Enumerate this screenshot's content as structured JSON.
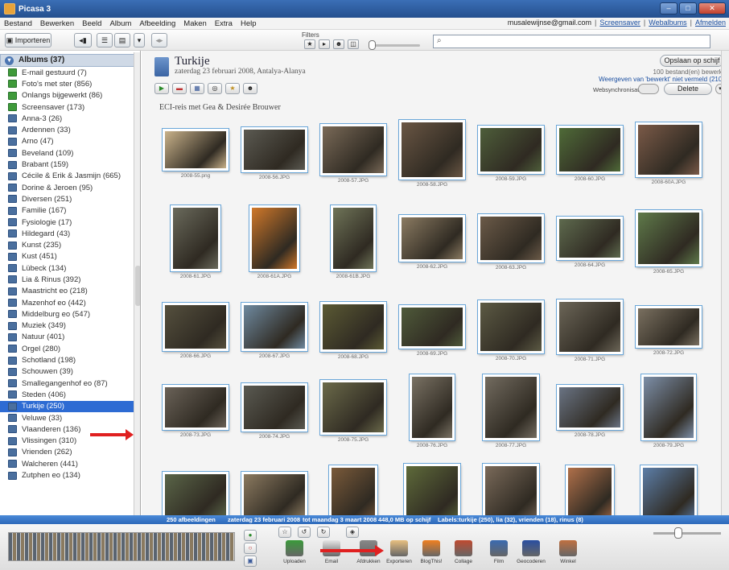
{
  "window": {
    "title": "Picasa 3"
  },
  "menu": [
    "Bestand",
    "Bewerken",
    "Beeld",
    "Album",
    "Afbeelding",
    "Maken",
    "Extra",
    "Help"
  ],
  "user": {
    "email": "musalewijnse@gmail.com",
    "links": [
      "Screensaver",
      "Webalbums",
      "Afmelden"
    ]
  },
  "toolbar": {
    "import_label": "Importeren",
    "filters_label": "Filters"
  },
  "sidebar": {
    "header": "Albums (37)",
    "albums": [
      {
        "label": "E-mail gestuurd (7)",
        "icon": "green"
      },
      {
        "label": "Foto's met ster (856)",
        "icon": "green"
      },
      {
        "label": "Onlangs bijgewerkt (86)",
        "icon": "green"
      },
      {
        "label": "Screensaver (173)",
        "icon": "green"
      },
      {
        "label": "Anna-3 (26)",
        "icon": "blue"
      },
      {
        "label": "Ardennen (33)",
        "icon": "blue"
      },
      {
        "label": "Arno (47)",
        "icon": "blue"
      },
      {
        "label": "Beveland (109)",
        "icon": "blue"
      },
      {
        "label": "Brabant (159)",
        "icon": "blue"
      },
      {
        "label": "Cécile & Erik & Jasmijn (665)",
        "icon": "blue"
      },
      {
        "label": "Dorine & Jeroen (95)",
        "icon": "blue"
      },
      {
        "label": "Diversen (251)",
        "icon": "blue"
      },
      {
        "label": "Familie (167)",
        "icon": "blue"
      },
      {
        "label": "Fysiologie (17)",
        "icon": "blue"
      },
      {
        "label": "Hildegard (43)",
        "icon": "blue"
      },
      {
        "label": "Kunst (235)",
        "icon": "blue"
      },
      {
        "label": "Kust (451)",
        "icon": "blue"
      },
      {
        "label": "Lübeck (134)",
        "icon": "blue"
      },
      {
        "label": "Lia & Rinus (392)",
        "icon": "blue"
      },
      {
        "label": "Maastricht eo (218)",
        "icon": "blue"
      },
      {
        "label": "Mazenhof eo (442)",
        "icon": "blue"
      },
      {
        "label": "Middelburg eo (547)",
        "icon": "blue"
      },
      {
        "label": "Muziek (349)",
        "icon": "blue"
      },
      {
        "label": "Natuur (401)",
        "icon": "blue"
      },
      {
        "label": "Orgel (280)",
        "icon": "blue"
      },
      {
        "label": "Schotland (198)",
        "icon": "blue"
      },
      {
        "label": "Schouwen (39)",
        "icon": "blue"
      },
      {
        "label": "Smallegangenhof eo (87)",
        "icon": "blue"
      },
      {
        "label": "Steden (406)",
        "icon": "blue"
      },
      {
        "label": "Turkije (250)",
        "icon": "blue",
        "selected": true
      },
      {
        "label": "Veluwe (33)",
        "icon": "blue"
      },
      {
        "label": "Vlaanderen (136)",
        "icon": "blue"
      },
      {
        "label": "Vlissingen (310)",
        "icon": "blue"
      },
      {
        "label": "Vrienden (262)",
        "icon": "blue"
      },
      {
        "label": "Walcheren (441)",
        "icon": "blue"
      },
      {
        "label": "Zutphen eo (134)",
        "icon": "blue"
      }
    ]
  },
  "album": {
    "title": "Turkije",
    "subtitle": "zaterdag 23 februari 2008, Antalya-Alanya",
    "caption": "ECI-reis met Gea & Desirée Brouwer",
    "save_button": "Opslaan op schijf",
    "files_info": "100 bestand(en) bewerkt",
    "show_link": "Weergeven van 'bewerkt' niet vermeld (210)",
    "sync_label": "Websynchronisatie",
    "delete_button": "Delete"
  },
  "photos": [
    {
      "name": "2008-55.png",
      "c": "#c9b28a"
    },
    {
      "name": "2008-56.JPG",
      "c": "#5b5a52"
    },
    {
      "name": "2008-57.JPG",
      "c": "#7a6a58"
    },
    {
      "name": "2008-58.JPG",
      "c": "#6a5644"
    },
    {
      "name": "2008-59.JPG",
      "c": "#4e5e3a"
    },
    {
      "name": "2008-60.JPG",
      "c": "#4f6b38"
    },
    {
      "name": "2008-60A.JPG",
      "c": "#7b5a48"
    },
    {
      "name": "2008-61.JPG",
      "c": "#6a6a5c"
    },
    {
      "name": "2008-61A.JPG",
      "c": "#d0782a"
    },
    {
      "name": "2008-61B.JPG",
      "c": "#6f7458"
    },
    {
      "name": "2008-62.JPG",
      "c": "#8b7b62"
    },
    {
      "name": "2008-63.JPG",
      "c": "#6b5a48"
    },
    {
      "name": "2008-64.JPG",
      "c": "#5e6a4e"
    },
    {
      "name": "2008-65.JPG",
      "c": "#5f7a4a"
    },
    {
      "name": "2008-66.JPG",
      "c": "#55503e"
    },
    {
      "name": "2008-67.JPG",
      "c": "#6f8aa0"
    },
    {
      "name": "2008-68.JPG",
      "c": "#5b5a34"
    },
    {
      "name": "2008-69.JPG",
      "c": "#4f5a3a"
    },
    {
      "name": "2008-70.JPG",
      "c": "#5c5a44"
    },
    {
      "name": "2008-71.JPG",
      "c": "#6c6658"
    },
    {
      "name": "2008-72.JPG",
      "c": "#7a7060"
    },
    {
      "name": "2008-73.JPG",
      "c": "#6a6258"
    },
    {
      "name": "2008-74.JPG",
      "c": "#5a5a52"
    },
    {
      "name": "2008-75.JPG",
      "c": "#6b6a4a"
    },
    {
      "name": "2008-76.JPG",
      "c": "#7a7264"
    },
    {
      "name": "2008-77.JPG",
      "c": "#736c60"
    },
    {
      "name": "2008-78.JPG",
      "c": "#6a7484"
    },
    {
      "name": "2008-79.JPG",
      "c": "#7d8fa8"
    },
    {
      "name": "",
      "c": "#5a6548"
    },
    {
      "name": "",
      "c": "#8b7a60"
    },
    {
      "name": "",
      "c": "#7a5a3a"
    },
    {
      "name": "",
      "c": "#5e6a3a"
    },
    {
      "name": "",
      "c": "#7a6a5a"
    },
    {
      "name": "",
      "c": "#b0704a"
    },
    {
      "name": "",
      "c": "#5c7ea8"
    }
  ],
  "status": {
    "count": "250 afbeeldingen",
    "date_from": "zaterdag 23 februari 2008",
    "date_to": "tot maandag 3 maart 2008",
    "size": "448,0 MB op schijf",
    "labels": "Labels:turkije (250), lia (32), vrienden (18), rinus (8)"
  },
  "tray": {
    "actions": [
      {
        "label": "Uploaden",
        "c": "#3a9a3a"
      },
      {
        "label": "Email",
        "c": "#e6e6e6"
      },
      {
        "label": "Afdrukken",
        "c": "#888888"
      },
      {
        "label": "Exporteren",
        "c": "#e8c080"
      },
      {
        "label": "BlogThis!",
        "c": "#f08020"
      },
      {
        "label": "Collage",
        "c": "#c04a30"
      },
      {
        "label": "Film",
        "c": "#3a6ab0"
      },
      {
        "label": "Geocoderen",
        "c": "#2a4ea0"
      },
      {
        "label": "Winkel",
        "c": "#c07040"
      }
    ]
  }
}
